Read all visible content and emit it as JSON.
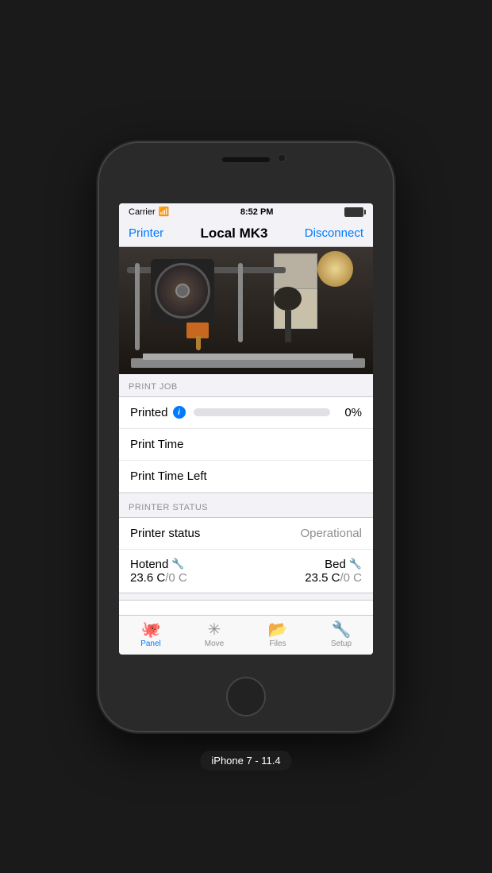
{
  "status_bar": {
    "carrier": "Carrier",
    "wifi": "📶",
    "time": "8:52 PM",
    "battery": 100
  },
  "nav": {
    "back_label": "Printer",
    "title": "Local MK3",
    "action_label": "Disconnect"
  },
  "print_job": {
    "section_title": "PRINT JOB",
    "printed_label": "Printed",
    "progress_pct": "0%",
    "progress_value": 0,
    "print_time_label": "Print Time",
    "print_time_value": "",
    "print_time_left_label": "Print Time Left",
    "print_time_left_value": ""
  },
  "printer_status": {
    "section_title": "PRINTER STATUS",
    "status_label": "Printer status",
    "status_value": "Operational",
    "hotend_label": "Hotend",
    "hotend_temp": "23.6 C",
    "hotend_target": "/0 C",
    "bed_label": "Bed",
    "bed_temp": "23.5 C",
    "bed_target": "/0 C"
  },
  "tabs": [
    {
      "id": "panel",
      "label": "Panel",
      "icon": "🐙",
      "active": true
    },
    {
      "id": "move",
      "label": "Move",
      "icon": "✳",
      "active": false
    },
    {
      "id": "files",
      "label": "Files",
      "icon": "📂",
      "active": false
    },
    {
      "id": "setup",
      "label": "Setup",
      "icon": "🔧",
      "active": false
    }
  ],
  "device_label": "iPhone 7 - 11.4"
}
